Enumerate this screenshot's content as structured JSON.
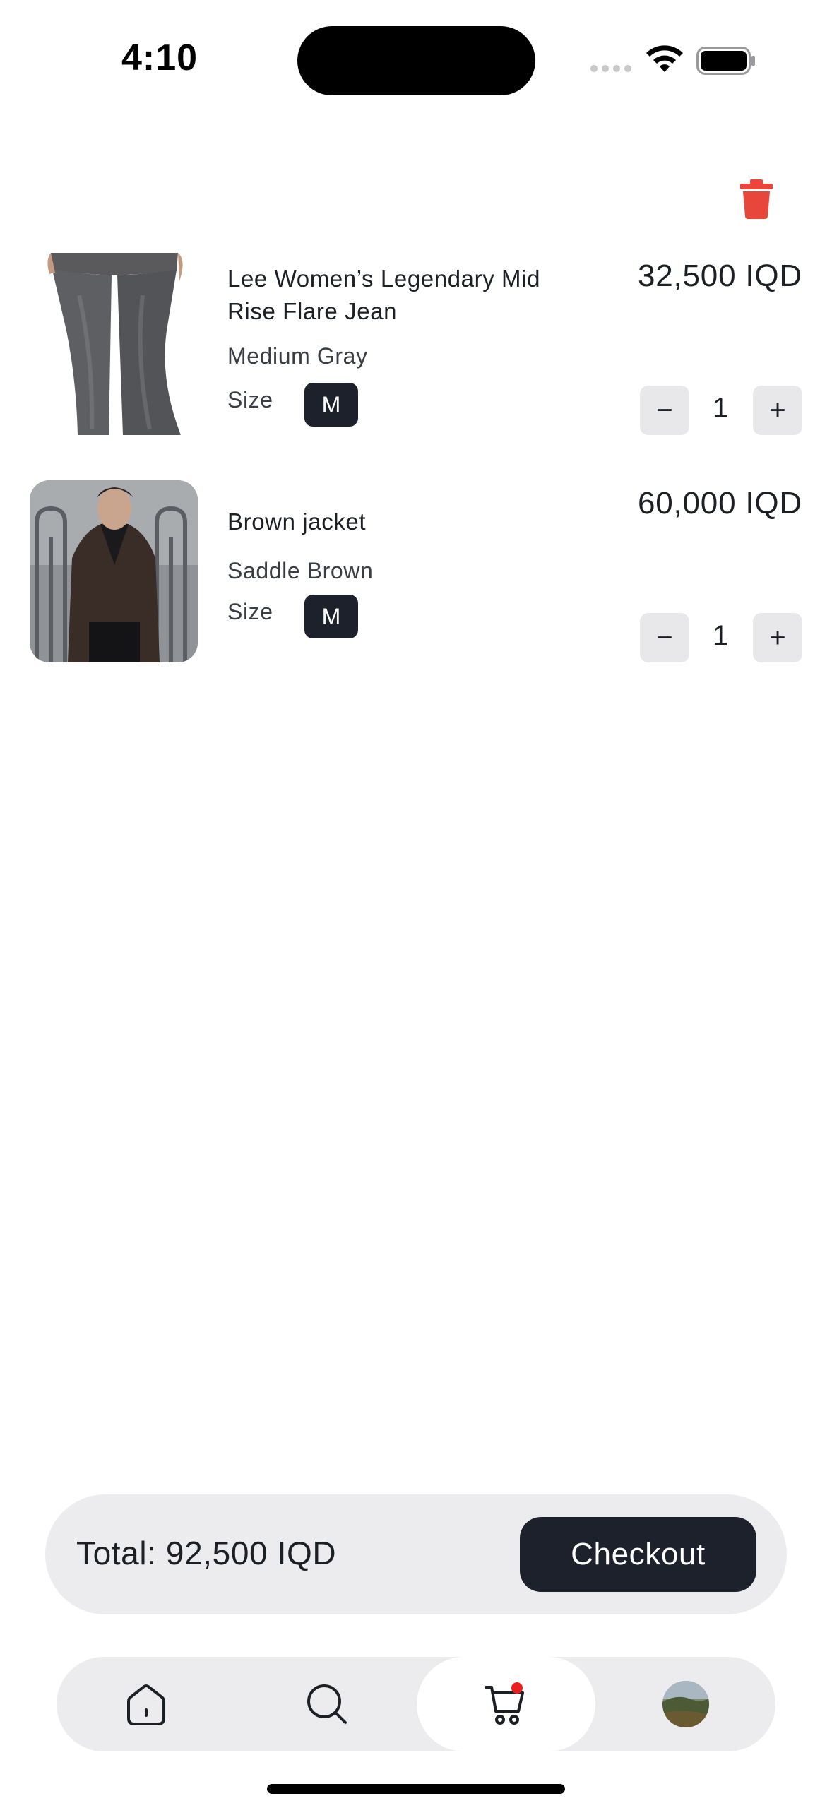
{
  "status_bar": {
    "time": "4:10"
  },
  "cart": {
    "delete_icon": "trash-icon",
    "items": [
      {
        "title": "Lee Women’s Legendary Mid Rise Flare Jean",
        "variant": "Medium Gray",
        "size_label": "Size",
        "size": "M",
        "price": "32,500 IQD",
        "quantity": "1",
        "decrement": "−",
        "increment": "+"
      },
      {
        "title": "Brown jacket",
        "variant": "Saddle Brown",
        "size_label": "Size",
        "size": "M",
        "price": "60,000 IQD",
        "quantity": "1",
        "decrement": "−",
        "increment": "+"
      }
    ]
  },
  "summary": {
    "total": "Total: 92,500 IQD",
    "checkout_label": "Checkout"
  },
  "nav": {
    "items": [
      "home-icon",
      "search-icon",
      "cart-icon",
      "profile-avatar"
    ],
    "active": "cart-icon"
  },
  "colors": {
    "accent_dark": "#1c212b",
    "delete_red": "#e8463a",
    "badge_red": "#e8201f",
    "surface": "#ececee"
  }
}
